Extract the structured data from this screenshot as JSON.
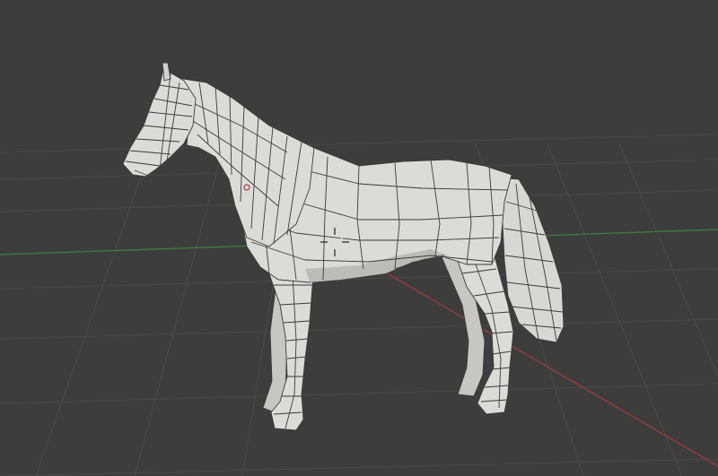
{
  "viewport": {
    "editor": "3d-viewport",
    "shading": "solid",
    "overlay": "wireframe-edges"
  },
  "scene": {
    "object": "horse-mesh",
    "grid_visible": true,
    "axes_visible": [
      "x-axis",
      "y-axis"
    ],
    "cursor_3d_visible": true,
    "origin_point_visible": true
  },
  "colors": {
    "background": "#3d3d3d",
    "grid": "#4b4b4b",
    "x_axis": "#a13a3a",
    "y_axis": "#3f7d3f",
    "mesh_fill": "#dddbd7",
    "mesh_shadow": "#bdbbb6",
    "wire": "#3a3a3a",
    "origin": "#b04050"
  }
}
